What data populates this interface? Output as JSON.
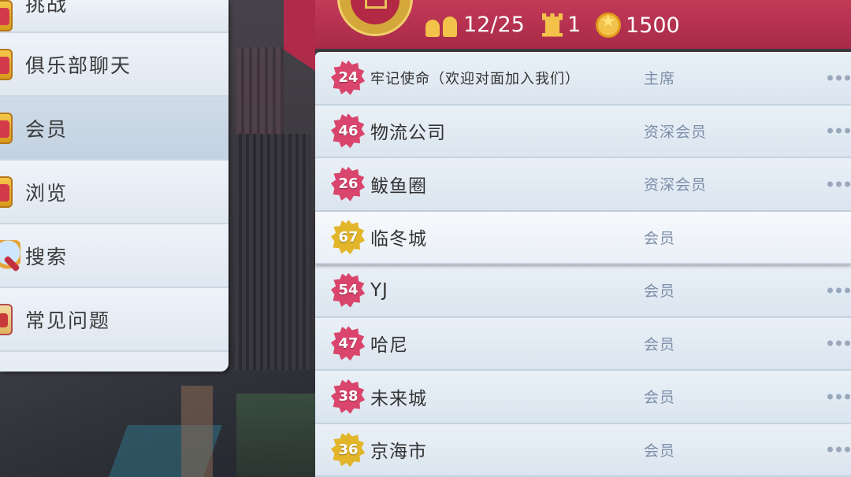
{
  "menu": {
    "items": [
      {
        "label": "挑战",
        "icon": "challenge-icon"
      },
      {
        "label": "俱乐部聊天",
        "icon": "club-chat-icon"
      },
      {
        "label": "会员",
        "icon": "members-icon",
        "active": true
      },
      {
        "label": "浏览",
        "icon": "browse-icon"
      },
      {
        "label": "搜索",
        "icon": "magnifier-icon"
      },
      {
        "label": "常见问题",
        "icon": "faq-icon"
      }
    ]
  },
  "header": {
    "members_count": "12/25",
    "towers": "1",
    "coins": "1500",
    "icons": [
      "club-shield-icon",
      "people-icon",
      "tower-icon",
      "coin-icon"
    ]
  },
  "members": [
    {
      "level": "24",
      "name": "牢记使命（欢迎对面加入我们）",
      "role": "主席",
      "badge": "pink"
    },
    {
      "level": "46",
      "name": "物流公司",
      "role": "资深会员",
      "badge": "pink"
    },
    {
      "level": "26",
      "name": "鲅鱼圈",
      "role": "资深会员",
      "badge": "pink"
    },
    {
      "level": "67",
      "name": "临冬城",
      "role": "会员",
      "badge": "gold"
    },
    {
      "level": "54",
      "name": "YJ",
      "role": "会员",
      "badge": "pink"
    },
    {
      "level": "47",
      "name": "哈尼",
      "role": "会员",
      "badge": "pink"
    },
    {
      "level": "38",
      "name": "未来城",
      "role": "会员",
      "badge": "pink"
    },
    {
      "level": "36",
      "name": "京海市",
      "role": "会员",
      "badge": "gold"
    }
  ],
  "colors": {
    "header_red": "#b32845",
    "badge_pink": "#d9456c",
    "badge_gold": "#e2b52a",
    "role_text": "#7d8ea8"
  }
}
